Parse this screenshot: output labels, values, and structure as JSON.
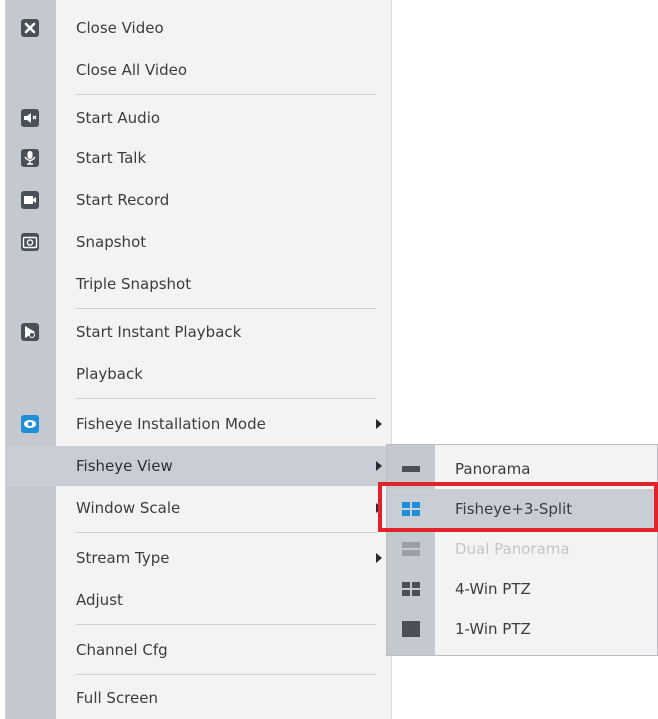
{
  "menu": {
    "items": [
      {
        "label": "Close Video",
        "icon": "close-icon"
      },
      {
        "label": "Close All Video"
      },
      {
        "label": "Start Audio",
        "icon": "speaker-icon"
      },
      {
        "label": "Start Talk",
        "icon": "microphone-icon"
      },
      {
        "label": "Start Record",
        "icon": "record-icon"
      },
      {
        "label": "Snapshot",
        "icon": "camera-icon"
      },
      {
        "label": "Triple Snapshot"
      },
      {
        "label": "Start Instant Playback",
        "icon": "instant-playback-icon"
      },
      {
        "label": "Playback"
      },
      {
        "label": "Fisheye Installation Mode",
        "icon": "fisheye-icon",
        "submenu": true
      },
      {
        "label": "Fisheye View",
        "submenu": true,
        "highlighted": true
      },
      {
        "label": "Window Scale",
        "submenu": true
      },
      {
        "label": "Stream Type",
        "submenu": true
      },
      {
        "label": "Adjust"
      },
      {
        "label": "Channel Cfg"
      },
      {
        "label": "Full Screen"
      }
    ]
  },
  "submenu": {
    "items": [
      {
        "label": "Panorama",
        "icon": "panorama-icon"
      },
      {
        "label": "Fisheye+3-Split",
        "icon": "fisheye-3-split-icon",
        "highlighted": true
      },
      {
        "label": "Dual Panorama",
        "icon": "dual-panorama-icon",
        "disabled": true
      },
      {
        "label": "4-Win PTZ",
        "icon": "four-window-icon"
      },
      {
        "label": "1-Win PTZ",
        "icon": "one-window-icon"
      }
    ]
  },
  "colors": {
    "highlight": "#c9ced6",
    "gutter": "#c4c8cf",
    "accent_blue": "#1e8fd8",
    "red_outline": "#e0232b"
  }
}
